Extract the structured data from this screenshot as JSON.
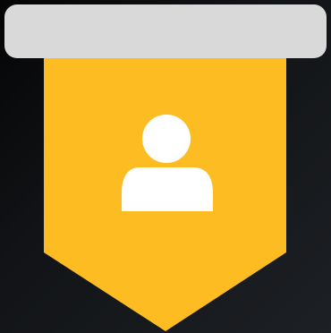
{
  "icon": {
    "name": "user-badge-icon",
    "parts": {
      "bar": "rounded-bar",
      "banner": "pennant-banner",
      "glyph": "user-icon"
    }
  },
  "colors": {
    "background_start": "#050505",
    "background_end": "#1d2024",
    "bar": "#d9d9d9",
    "banner": "#fdbd22",
    "glyph": "#ffffff"
  }
}
